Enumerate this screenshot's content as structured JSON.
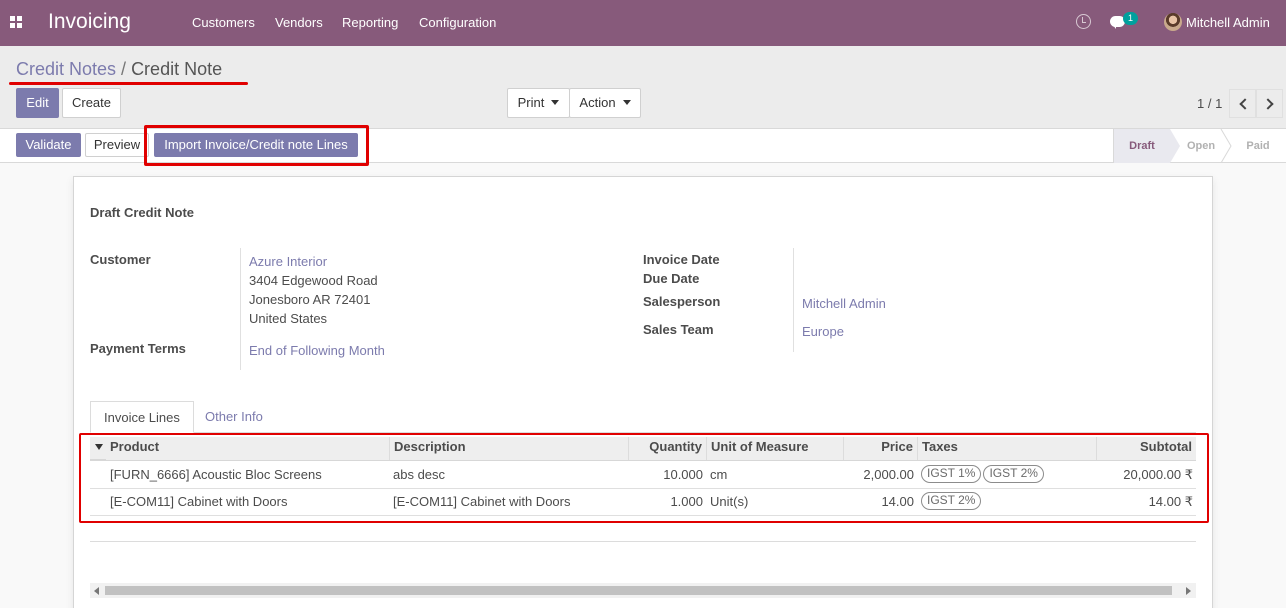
{
  "app": {
    "title": "Invoicing",
    "menu": [
      "Customers",
      "Vendors",
      "Reporting",
      "Configuration"
    ],
    "chat_count": "1",
    "user_name": "Mitchell Admin",
    "brand_color": "#875a7b",
    "accent_color": "#7c7bad"
  },
  "breadcrumb": {
    "parent": "Credit Notes",
    "separator": "/",
    "current": "Credit Note"
  },
  "buttons": {
    "edit": "Edit",
    "create": "Create",
    "print": "Print",
    "action": "Action",
    "validate": "Validate",
    "preview": "Preview",
    "import_lines": "Import Invoice/Credit note Lines"
  },
  "pager": {
    "value": "1 / 1"
  },
  "status": {
    "stages": [
      "Draft",
      "Open",
      "Paid"
    ],
    "active": "Draft"
  },
  "form": {
    "title": "Draft Credit Note",
    "customer_label": "Customer",
    "customer_name": "Azure Interior",
    "customer_address": [
      "3404 Edgewood Road",
      "Jonesboro AR 72401",
      "United States"
    ],
    "payment_terms_label": "Payment Terms",
    "payment_terms": "End of Following Month",
    "invoice_date_label": "Invoice Date",
    "due_date_label": "Due Date",
    "salesperson_label": "Salesperson",
    "salesperson": "Mitchell Admin",
    "sales_team_label": "Sales Team",
    "sales_team": "Europe"
  },
  "tabs": [
    "Invoice Lines",
    "Other Info"
  ],
  "table": {
    "columns": [
      "Product",
      "Description",
      "Quantity",
      "Unit of Measure",
      "Price",
      "Taxes",
      "Subtotal"
    ],
    "rows": [
      {
        "product": "[FURN_6666] Acoustic Bloc Screens",
        "description": "abs desc",
        "quantity": "10.000",
        "uom": "cm",
        "price": "2,000.00",
        "taxes": [
          "IGST 1%",
          "IGST 2%"
        ],
        "subtotal": "20,000.00 ₹"
      },
      {
        "product": "[E-COM11] Cabinet with Doors",
        "description": "[E-COM11] Cabinet with Doors",
        "quantity": "1.000",
        "uom": "Unit(s)",
        "price": "14.00",
        "taxes": [
          "IGST 2%"
        ],
        "subtotal": "14.00 ₹"
      }
    ]
  }
}
